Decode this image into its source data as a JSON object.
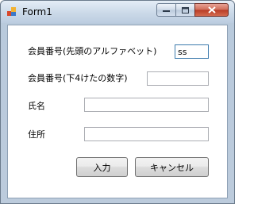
{
  "window": {
    "title": "Form1"
  },
  "titlebar_buttons": {
    "minimize": "minimize-icon",
    "maximize": "maximize-icon",
    "close": "close-icon"
  },
  "form": {
    "member_initial_label": "会員番号(先頭のアルファベット)",
    "member_initial_value": "ss",
    "member_digits_label": "会員番号(下4けたの数字)",
    "member_digits_value": "",
    "name_label": "氏名",
    "name_value": "",
    "address_label": "住所",
    "address_value": ""
  },
  "buttons": {
    "submit_label": "入力",
    "cancel_label": "キャンセル"
  }
}
